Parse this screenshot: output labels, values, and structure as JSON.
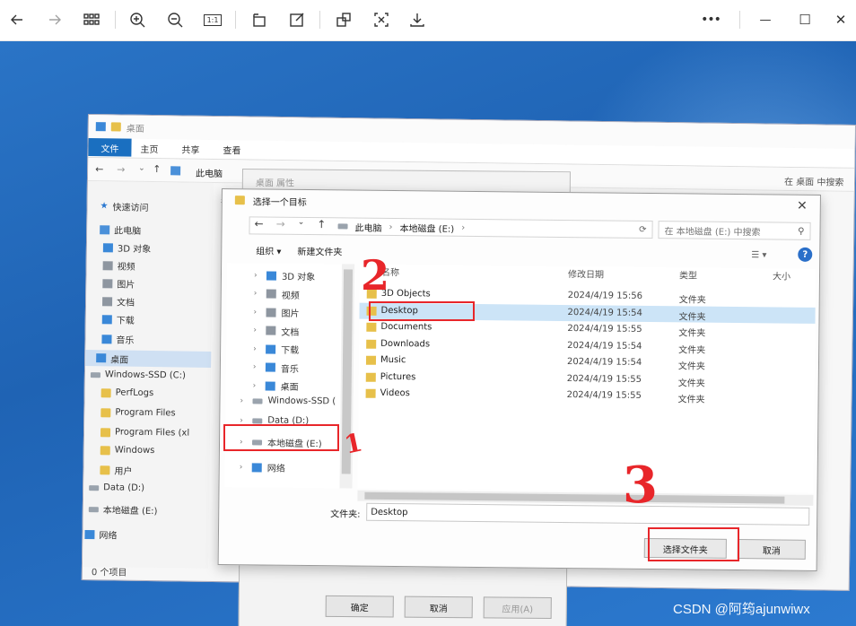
{
  "viewer": {
    "more_label": "•••",
    "minimize_label": "—",
    "maximize_label": "☐",
    "close_label": "✕",
    "zoom_box_label": "1:1"
  },
  "explorer": {
    "title": "桌面",
    "ribbon": {
      "file": "文件",
      "home": "主页",
      "share": "共享",
      "view": "查看"
    },
    "address": "此电脑",
    "search_placeholder": "在 桌面 中搜索",
    "column_name": "名称",
    "nav": [
      {
        "label": "快速访问",
        "icon": "star"
      },
      {
        "label": "此电脑",
        "icon": "pc"
      },
      {
        "label": "3D 对象",
        "icon": "blue"
      },
      {
        "label": "视频",
        "icon": "gray"
      },
      {
        "label": "图片",
        "icon": "gray"
      },
      {
        "label": "文档",
        "icon": "gray"
      },
      {
        "label": "下载",
        "icon": "blue"
      },
      {
        "label": "音乐",
        "icon": "blue"
      },
      {
        "label": "桌面",
        "icon": "blue"
      },
      {
        "label": "Windows-SSD (C:)",
        "icon": "drive"
      },
      {
        "label": "PerfLogs",
        "icon": "folder"
      },
      {
        "label": "Program Files",
        "icon": "folder"
      },
      {
        "label": "Program Files (xl",
        "icon": "folder"
      },
      {
        "label": "Windows",
        "icon": "folder"
      },
      {
        "label": "用户",
        "icon": "folder"
      },
      {
        "label": "Data (D:)",
        "icon": "drive"
      },
      {
        "label": "本地磁盘 (E:)",
        "icon": "drive"
      },
      {
        "label": "网络",
        "icon": "blue"
      }
    ],
    "status": "0 个项目"
  },
  "properties": {
    "title": "桌面 属性",
    "ok": "确定",
    "cancel": "取消",
    "apply": "应用(A)"
  },
  "dialog": {
    "title": "选择一个目标",
    "breadcrumb": [
      "此电脑",
      "本地磁盘 (E:)"
    ],
    "search_placeholder": "在 本地磁盘 (E:) 中搜索",
    "toolbar": {
      "organize": "组织 ▾",
      "new_folder": "新建文件夹"
    },
    "tree": [
      {
        "label": "3D 对象",
        "icon": "blue"
      },
      {
        "label": "视频",
        "icon": "gray"
      },
      {
        "label": "图片",
        "icon": "gray"
      },
      {
        "label": "文档",
        "icon": "gray"
      },
      {
        "label": "下载",
        "icon": "blue"
      },
      {
        "label": "音乐",
        "icon": "blue"
      },
      {
        "label": "桌面",
        "icon": "blue"
      },
      {
        "label": "Windows-SSD (",
        "icon": "drive"
      },
      {
        "label": "Data (D:)",
        "icon": "drive"
      },
      {
        "label": "本地磁盘 (E:)",
        "icon": "drive"
      },
      {
        "label": "网络",
        "icon": "blue"
      }
    ],
    "columns": {
      "name": "名称",
      "date": "修改日期",
      "type": "类型",
      "size": "大小"
    },
    "files": [
      {
        "name": "3D Objects",
        "date": "2024/4/19 15:56",
        "type": "文件夹"
      },
      {
        "name": "Desktop",
        "date": "2024/4/19 15:54",
        "type": "文件夹"
      },
      {
        "name": "Documents",
        "date": "2024/4/19 15:55",
        "type": "文件夹"
      },
      {
        "name": "Downloads",
        "date": "2024/4/19 15:54",
        "type": "文件夹"
      },
      {
        "name": "Music",
        "date": "2024/4/19 15:54",
        "type": "文件夹"
      },
      {
        "name": "Pictures",
        "date": "2024/4/19 15:55",
        "type": "文件夹"
      },
      {
        "name": "Videos",
        "date": "2024/4/19 15:55",
        "type": "文件夹"
      }
    ],
    "folder_label": "文件夹:",
    "folder_value": "Desktop",
    "select_button": "选择文件夹",
    "cancel_button": "取消"
  },
  "annotations": {
    "step1": "1",
    "step2": "2",
    "step3": "3"
  },
  "watermark": "CSDN @阿筠ajunwiwx",
  "colors": {
    "annotation": "#e8262a",
    "wallpaper": "#2a74c6",
    "selection": "#cce4f7"
  }
}
